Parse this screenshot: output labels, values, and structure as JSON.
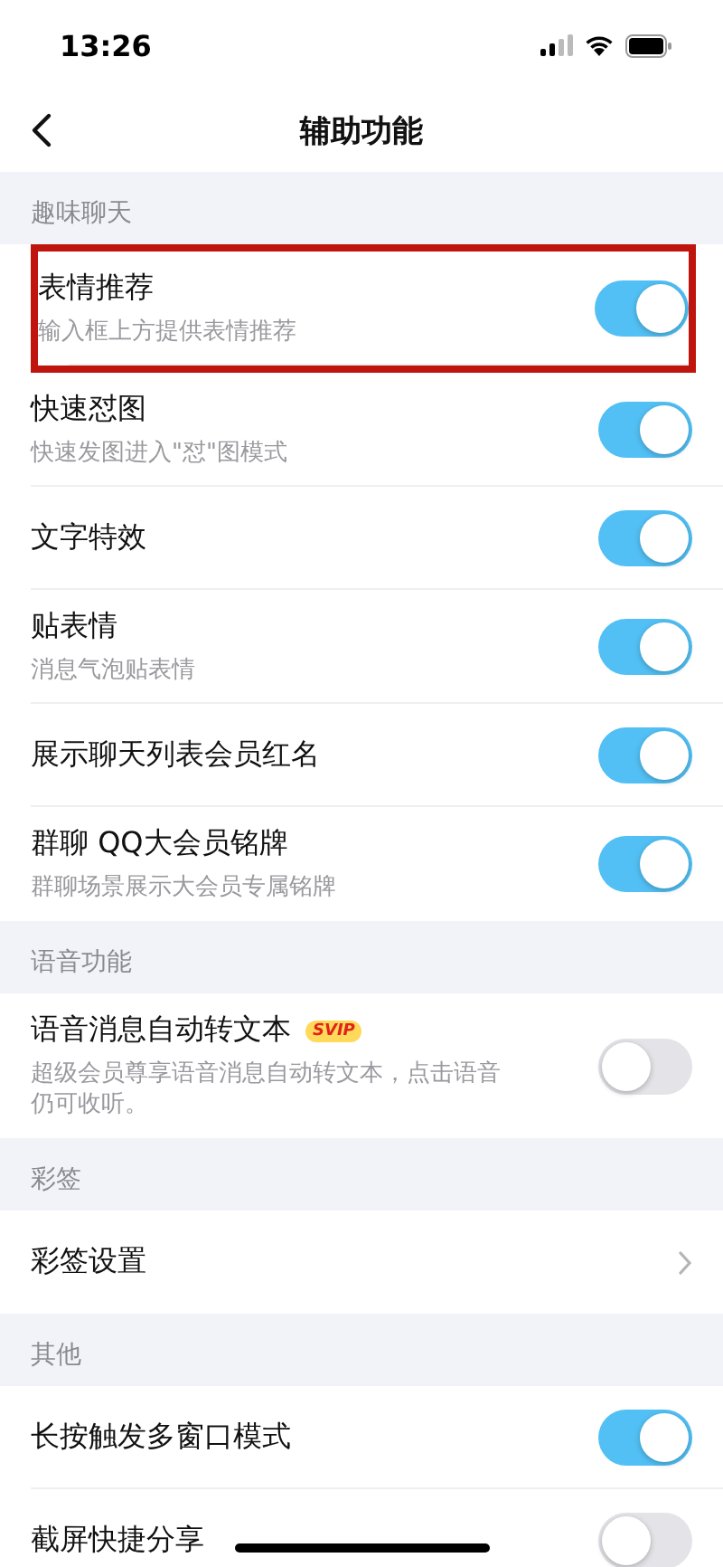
{
  "status_bar": {
    "time": "13:26"
  },
  "nav": {
    "title": "辅助功能"
  },
  "sections": [
    {
      "header": "趣味聊天",
      "items": [
        {
          "kind": "toggle",
          "title": "表情推荐",
          "subtitle": "输入框上方提供表情推荐",
          "on": true,
          "highlighted": true
        },
        {
          "kind": "toggle",
          "title": "快速怼图",
          "subtitle": "快速发图进入\"怼\"图模式",
          "on": true
        },
        {
          "kind": "toggle",
          "title": "文字特效",
          "on": true
        },
        {
          "kind": "toggle",
          "title": "贴表情",
          "subtitle": "消息气泡贴表情",
          "on": true
        },
        {
          "kind": "toggle",
          "title": "展示聊天列表会员红名",
          "on": true
        },
        {
          "kind": "toggle",
          "title": "群聊 QQ大会员铭牌",
          "subtitle": "群聊场景展示大会员专属铭牌",
          "on": true
        }
      ]
    },
    {
      "header": "语音功能",
      "items": [
        {
          "kind": "toggle",
          "title": "语音消息自动转文本",
          "badge": "SVIP",
          "subtitle": "超级会员尊享语音消息自动转文本，点击语音仍可收听。",
          "on": false
        }
      ]
    },
    {
      "header": "彩签",
      "items": [
        {
          "kind": "link",
          "title": "彩签设置"
        }
      ]
    },
    {
      "header": "其他",
      "items": [
        {
          "kind": "toggle",
          "title": "长按触发多窗口模式",
          "on": true
        },
        {
          "kind": "toggle",
          "title": "截屏快捷分享",
          "on": false
        }
      ]
    }
  ]
}
